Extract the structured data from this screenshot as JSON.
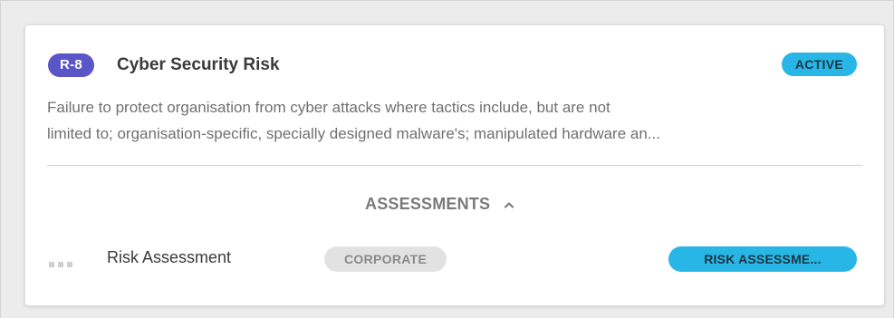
{
  "risk": {
    "id": "R-8",
    "title": "Cyber Security Risk",
    "status": "ACTIVE",
    "description_line_1": "Failure to protect organisation from cyber attacks where tactics include, but are not",
    "description_line_2": "limited to; organisation-specific, specially designed malware's; manipulated hardware an..."
  },
  "assessments": {
    "header": "ASSESSMENTS",
    "expanded": true,
    "items": [
      {
        "name": "Risk Assessment",
        "category": "CORPORATE",
        "type": "RISK ASSESSME..."
      }
    ]
  },
  "colors": {
    "id_badge": "#5b56c8",
    "status_badge": "#27b6e6",
    "category_badge": "#e2e2e2",
    "type_badge": "#27b6e6"
  },
  "icons": {
    "expand_toggle": "chevron-up-icon",
    "row_handle": "drag-handle-icon"
  }
}
